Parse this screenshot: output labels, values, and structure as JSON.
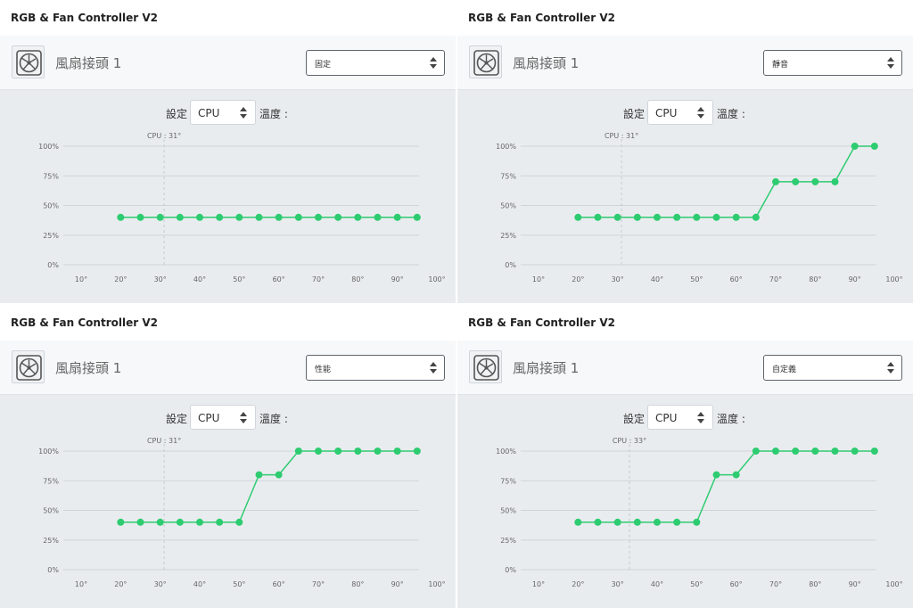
{
  "panels": [
    {
      "title": "RGB & Fan Controller V2",
      "fan_label": "風扇接頭 1",
      "mode": "固定",
      "setting_label": "設定",
      "sensor": "CPU",
      "temp_label": "溫度 :",
      "cpu_marker": "CPU : 31°",
      "cpu_marker_temp": 31,
      "chart_data": {
        "type": "line",
        "x": [
          20,
          25,
          30,
          35,
          40,
          45,
          50,
          55,
          60,
          65,
          70,
          75,
          80,
          85,
          90,
          95
        ],
        "values": [
          40,
          40,
          40,
          40,
          40,
          40,
          40,
          40,
          40,
          40,
          40,
          40,
          40,
          40,
          40,
          40
        ],
        "xlim": [
          10,
          100
        ],
        "ylim": [
          0,
          100
        ],
        "x_ticks": [
          "10°",
          "20°",
          "30°",
          "40°",
          "50°",
          "60°",
          "70°",
          "80°",
          "90°",
          "100°"
        ],
        "y_ticks": [
          "0%",
          "25%",
          "50%",
          "75%",
          "100%"
        ],
        "color": "#2ecc71",
        "grid": true
      }
    },
    {
      "title": "RGB & Fan Controller V2",
      "fan_label": "風扇接頭 1",
      "mode": "靜音",
      "setting_label": "設定",
      "sensor": "CPU",
      "temp_label": "溫度 :",
      "cpu_marker": "CPU : 31°",
      "cpu_marker_temp": 31,
      "chart_data": {
        "type": "line",
        "x": [
          20,
          25,
          30,
          35,
          40,
          45,
          50,
          55,
          60,
          65,
          70,
          75,
          80,
          85,
          90,
          95
        ],
        "values": [
          40,
          40,
          40,
          40,
          40,
          40,
          40,
          40,
          40,
          40,
          70,
          70,
          70,
          70,
          100,
          100
        ],
        "xlim": [
          10,
          100
        ],
        "ylim": [
          0,
          100
        ],
        "x_ticks": [
          "10°",
          "20°",
          "30°",
          "40°",
          "50°",
          "60°",
          "70°",
          "80°",
          "90°",
          "100°"
        ],
        "y_ticks": [
          "0%",
          "25%",
          "50%",
          "75%",
          "100%"
        ],
        "color": "#2ecc71",
        "grid": true
      }
    },
    {
      "title": "RGB & Fan Controller V2",
      "fan_label": "風扇接頭 1",
      "mode": "性能",
      "setting_label": "設定",
      "sensor": "CPU",
      "temp_label": "溫度 :",
      "cpu_marker": "CPU : 31°",
      "cpu_marker_temp": 31,
      "chart_data": {
        "type": "line",
        "x": [
          20,
          25,
          30,
          35,
          40,
          45,
          50,
          55,
          60,
          65,
          70,
          75,
          80,
          85,
          90,
          95
        ],
        "values": [
          40,
          40,
          40,
          40,
          40,
          40,
          40,
          80,
          80,
          100,
          100,
          100,
          100,
          100,
          100,
          100
        ],
        "xlim": [
          10,
          100
        ],
        "ylim": [
          0,
          100
        ],
        "x_ticks": [
          "10°",
          "20°",
          "30°",
          "40°",
          "50°",
          "60°",
          "70°",
          "80°",
          "90°",
          "100°"
        ],
        "y_ticks": [
          "0%",
          "25%",
          "50%",
          "75%",
          "100%"
        ],
        "color": "#2ecc71",
        "grid": true
      }
    },
    {
      "title": "RGB & Fan Controller V2",
      "fan_label": "風扇接頭 1",
      "mode": "自定義",
      "setting_label": "設定",
      "sensor": "CPU",
      "temp_label": "溫度 :",
      "cpu_marker": "CPU : 33°",
      "cpu_marker_temp": 33,
      "chart_data": {
        "type": "line",
        "x": [
          20,
          25,
          30,
          35,
          40,
          45,
          50,
          55,
          60,
          65,
          70,
          75,
          80,
          85,
          90,
          95
        ],
        "values": [
          40,
          40,
          40,
          40,
          40,
          40,
          40,
          80,
          80,
          100,
          100,
          100,
          100,
          100,
          100,
          100
        ],
        "xlim": [
          10,
          100
        ],
        "ylim": [
          0,
          100
        ],
        "x_ticks": [
          "10°",
          "20°",
          "30°",
          "40°",
          "50°",
          "60°",
          "70°",
          "80°",
          "90°",
          "100°"
        ],
        "y_ticks": [
          "0%",
          "25%",
          "50%",
          "75%",
          "100%"
        ],
        "color": "#2ecc71",
        "grid": true
      }
    }
  ]
}
